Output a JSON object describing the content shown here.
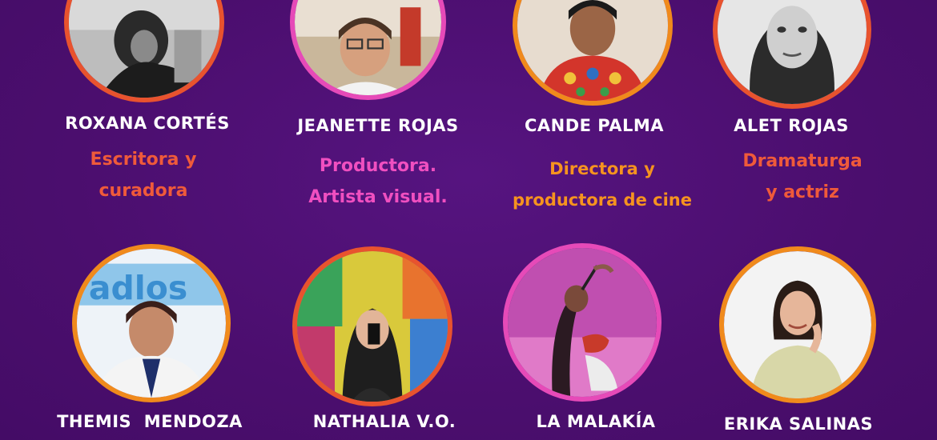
{
  "people": [
    {
      "name": "ROXANA CORTÉS",
      "role": [
        "Escritora y",
        "curadora"
      ],
      "ring": "#e8532e",
      "role_color": "#ef5a3a",
      "photo": "black-and-white portrait"
    },
    {
      "name": "JEANETTE ROJAS",
      "role": [
        "Productora.",
        "Artista visual."
      ],
      "ring": "#e64ab8",
      "role_color": "#f04fc0",
      "photo": "smiling woman with glasses"
    },
    {
      "name": "CANDE PALMA",
      "role": [
        "Directora y",
        "productora de cine"
      ],
      "ring": "#f08a1c",
      "role_color": "#f6931f",
      "photo": "woman in embroidered red blouse"
    },
    {
      "name": "ALET ROJAS",
      "role": [
        "Dramaturga",
        "y actriz"
      ],
      "ring": "#e8532e",
      "role_color": "#ef5a3a",
      "photo": "black-and-white portrait"
    },
    {
      "name": "THEMIS  MENDOZA",
      "role": [],
      "ring": "#f08a1c",
      "role_color": "#f6931f",
      "photo": "woman with glasses and white jacket"
    },
    {
      "name": "NATHALIA V.O.",
      "role": [],
      "ring": "#e8532e",
      "role_color": "#ef5a3a",
      "photo": "mirror selfie with graffiti wall"
    },
    {
      "name": "LA MALAKÍA",
      "role": [],
      "ring": "#e64ab8",
      "role_color": "#f04fc0",
      "photo": "performer singing with microphone"
    },
    {
      "name": "ERIKA SALINAS",
      "role": [],
      "ring": "#f08a1c",
      "role_color": "#f6931f",
      "photo": "woman in light green top"
    }
  ]
}
